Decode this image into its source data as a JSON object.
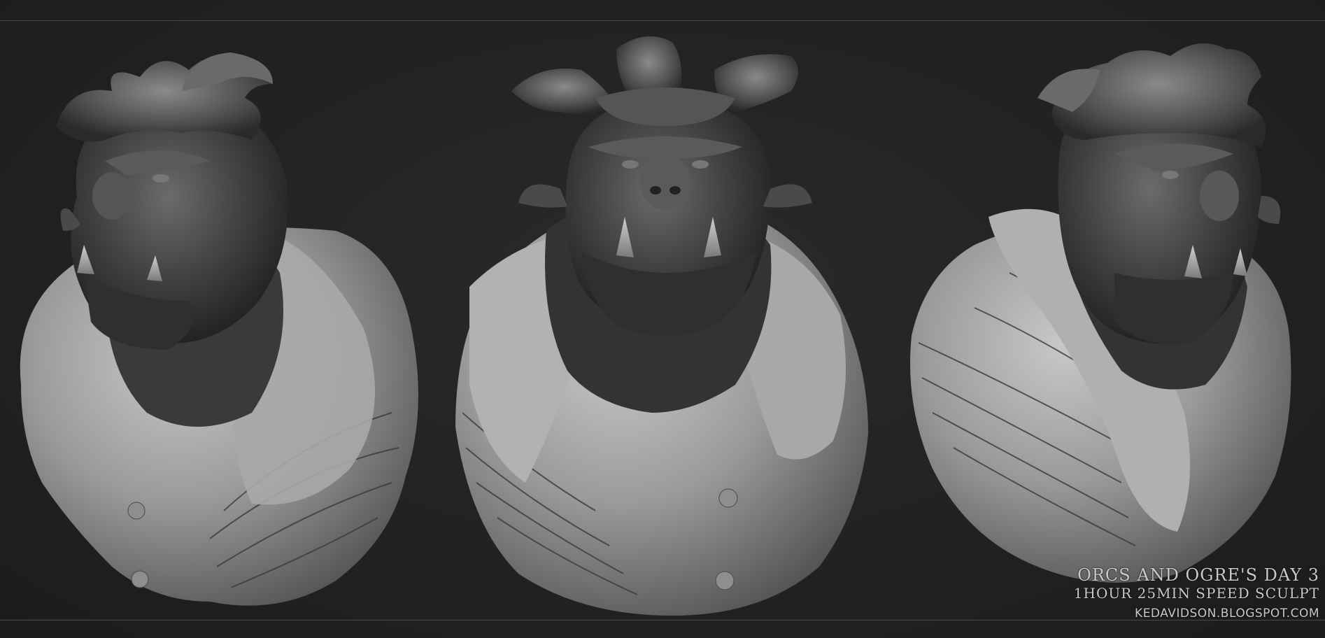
{
  "caption": {
    "title": "ORCS AND OGRE'S DAY 3",
    "subtitle": "1HOUR 25MIN SPEED SCULPT",
    "site": "KEDAVIDSON.BLOGSPOT.COM"
  },
  "colors": {
    "background": "#222222",
    "rule": "#4a4a4a",
    "clay_dark": "#3a3a3a",
    "clay_light": "#b5b5b5",
    "caption_text": "#c9c9c9"
  },
  "views": [
    {
      "id": "left",
      "orientation": "three-quarter left"
    },
    {
      "id": "center",
      "orientation": "front"
    },
    {
      "id": "right",
      "orientation": "three-quarter right"
    }
  ]
}
